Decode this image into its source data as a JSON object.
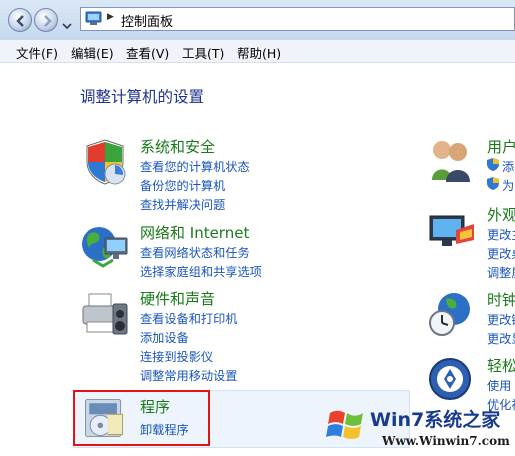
{
  "window": {
    "breadcrumb_sep": "▶",
    "breadcrumb": "控制面板",
    "back_label": "",
    "forward_label": ""
  },
  "menu": [
    "文件(F)",
    "编辑(E)",
    "查看(V)",
    "工具(T)",
    "帮助(H)"
  ],
  "heading": "调整计算机的设置",
  "categories": {
    "system": {
      "title": "系统和安全",
      "links": [
        "查看您的计算机状态",
        "备份您的计算机",
        "查找并解决问题"
      ]
    },
    "network": {
      "title": "网络和 Internet",
      "links": [
        "查看网络状态和任务",
        "选择家庭组和共享选项"
      ]
    },
    "hardware": {
      "title": "硬件和声音",
      "links": [
        "查看设备和打印机",
        "添加设备",
        "连接到投影仪",
        "调整常用移动设置"
      ]
    },
    "programs": {
      "title": "程序",
      "links": [
        "卸载程序"
      ]
    },
    "users": {
      "title": "用户",
      "links": [
        "添",
        "为"
      ]
    },
    "appearance": {
      "title": "外观",
      "links": [
        "更改主",
        "更改桌",
        "调整屏"
      ]
    },
    "clock": {
      "title": "时钟",
      "links": [
        "更改键",
        "更改显"
      ]
    },
    "access": {
      "title": "轻松",
      "links": [
        "使用",
        "优化视"
      ]
    }
  },
  "watermark": {
    "brand": "Win7系统之家",
    "url": "Www.Winwin7.com"
  },
  "colors": {
    "category_title": "#1a7a1a",
    "link": "#1a56b8",
    "heading": "#1e3287",
    "highlight_box": "#e01515"
  }
}
